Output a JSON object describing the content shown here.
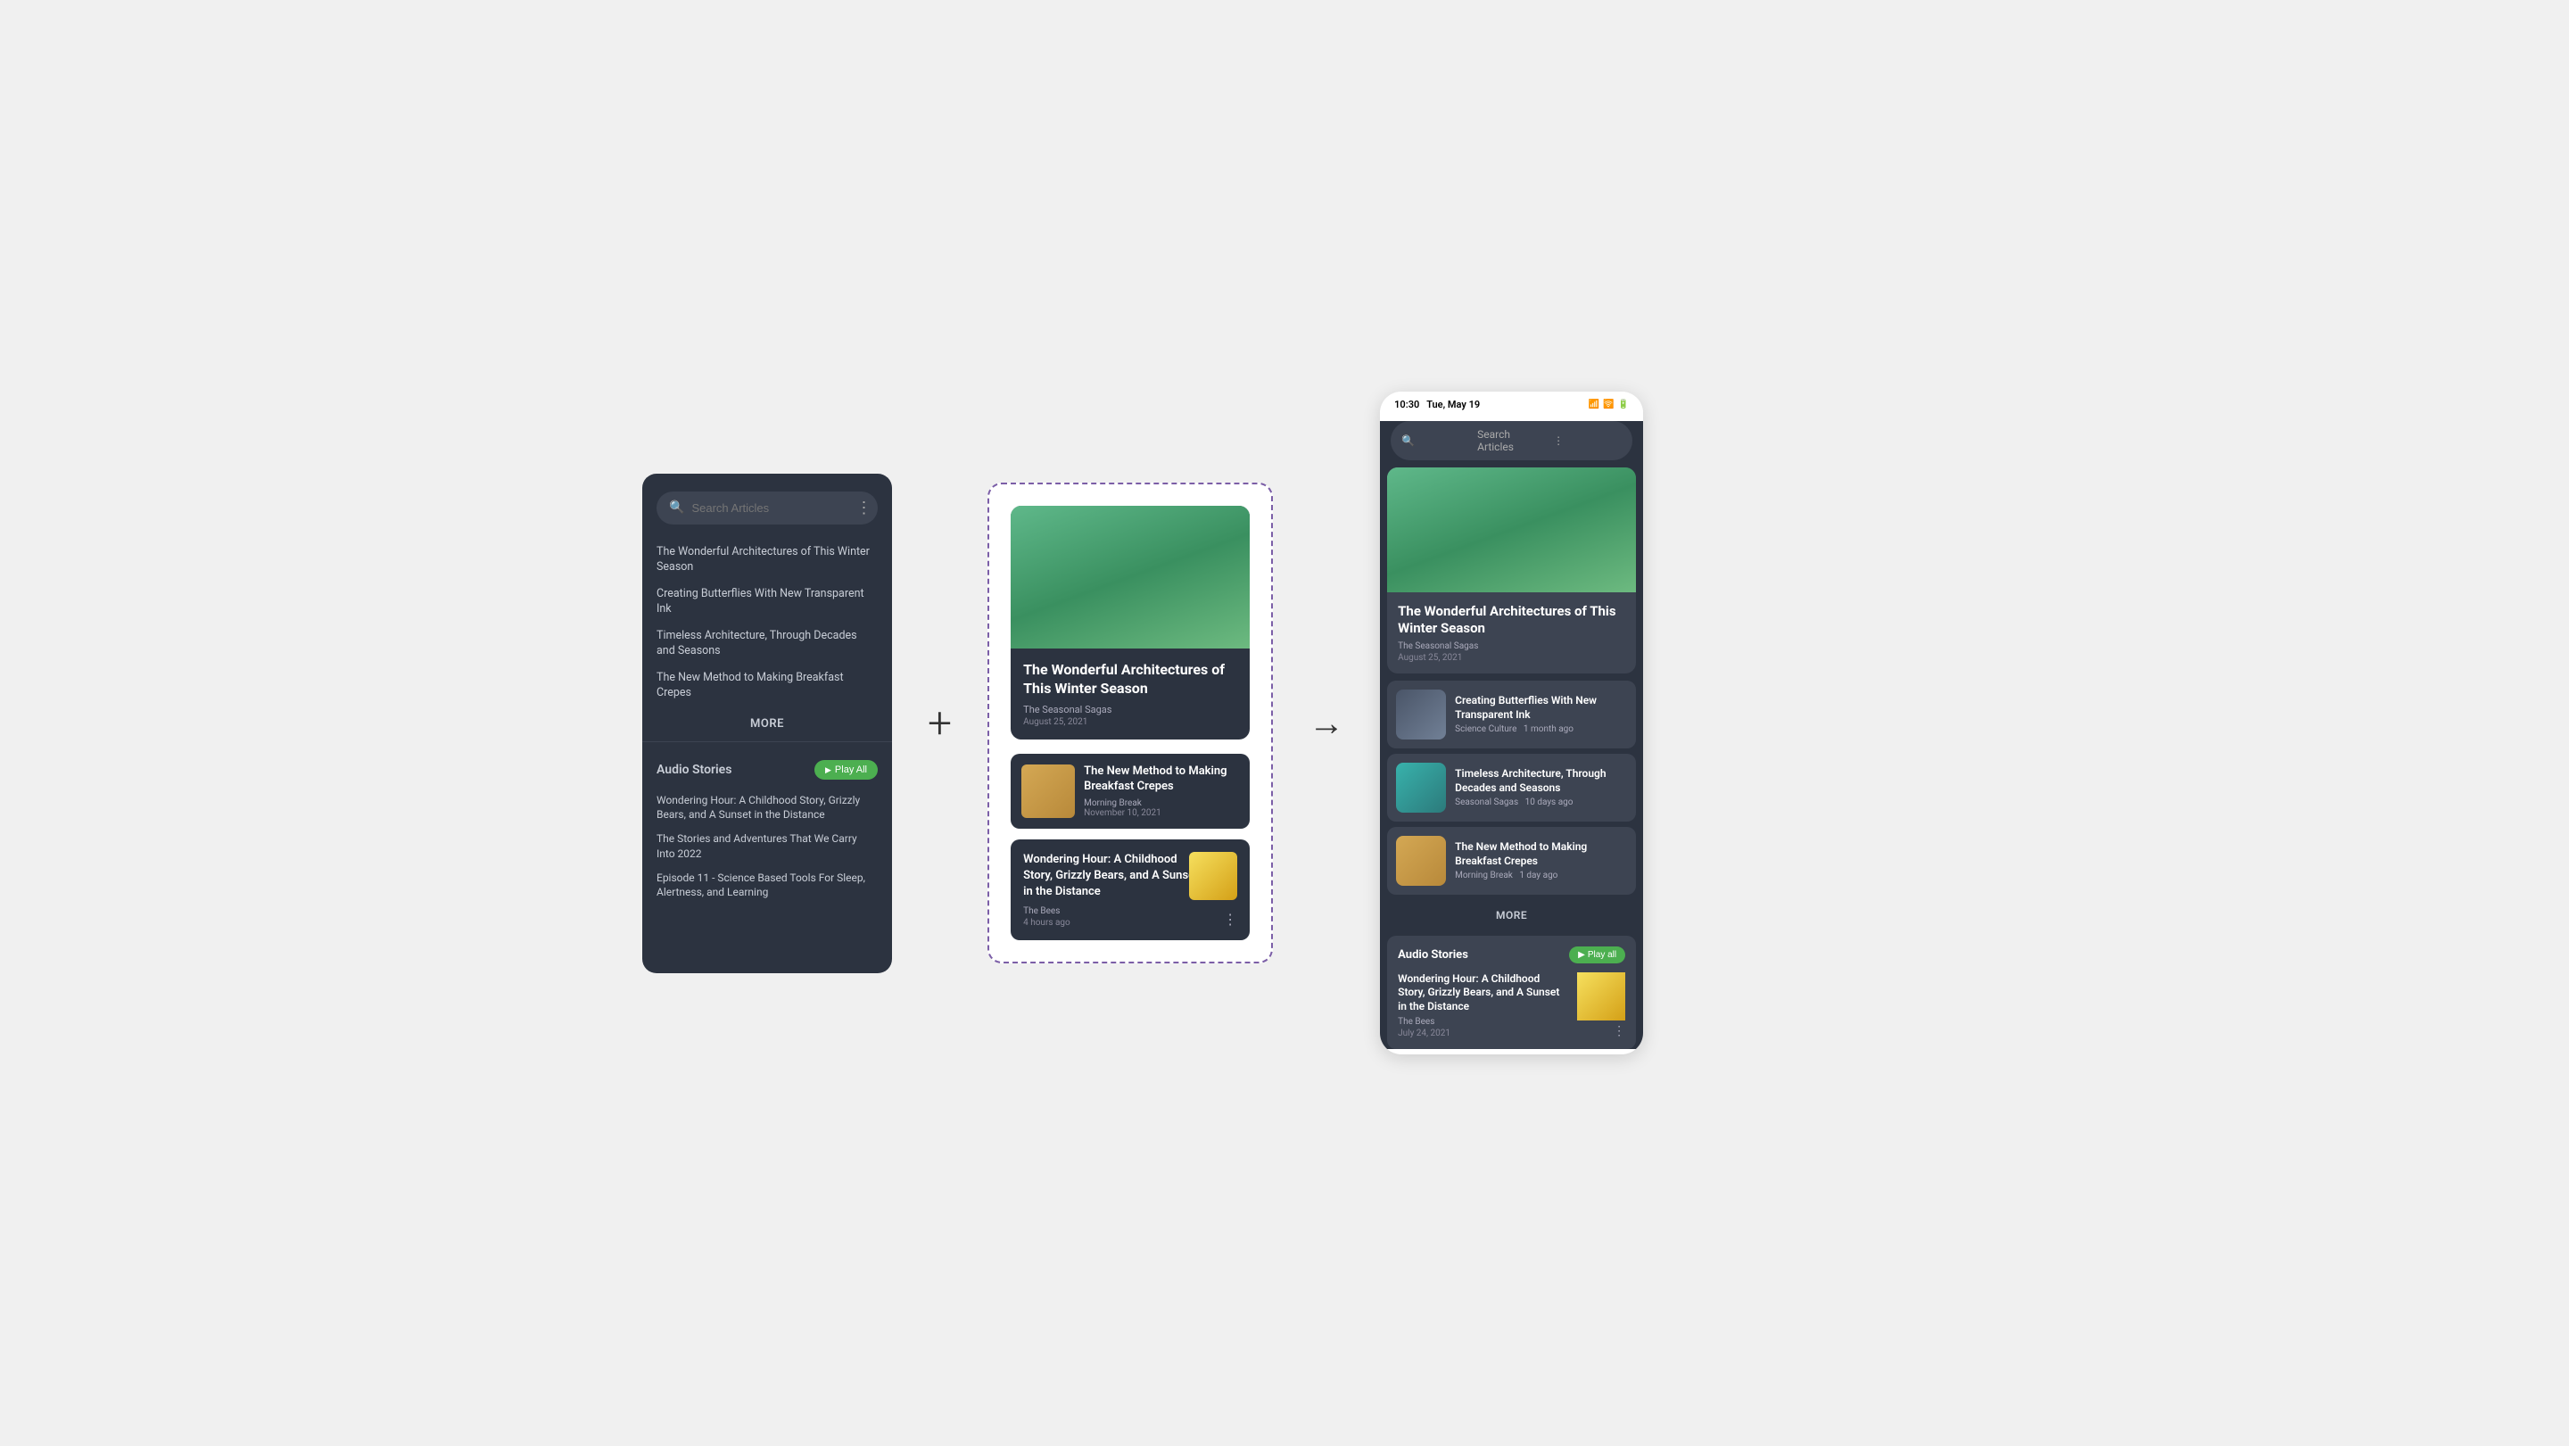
{
  "leftPhone": {
    "search": {
      "placeholder": "Search Articles"
    },
    "articles": [
      {
        "title": "The Wonderful Architectures of This Winter Season"
      },
      {
        "title": "Creating Butterflies With New Transparent Ink"
      },
      {
        "title": "Timeless Architecture, Through Decades and Seasons"
      },
      {
        "title": "The New Method to Making Breakfast Crepes"
      }
    ],
    "more_label": "MORE",
    "audioSection": {
      "title": "Audio Stories",
      "play_all": "Play All",
      "items": [
        {
          "title": "Wondering Hour: A Childhood Story, Grizzly Bears, and A Sunset in the Distance"
        },
        {
          "title": "The Stories and Adventures That We Carry Into 2022"
        },
        {
          "title": "Episode 11 - Science Based Tools For Sleep, Alertness, and Learning"
        }
      ]
    }
  },
  "centerBox": {
    "featured": {
      "title": "The Wonderful Architectures of This Winter Season",
      "subtitle": "The Seasonal Sagas",
      "date": "August 25, 2021"
    },
    "articles": [
      {
        "title": "The New Method to Making Breakfast Crepes",
        "category": "Morning Break",
        "date": "November 10, 2021"
      }
    ],
    "podcast": {
      "title": "Wondering Hour: A Childhood Story, Grizzly Bears, and A Sunset in the Distance",
      "author": "The Bees",
      "time": "4 hours ago"
    }
  },
  "rightPhone": {
    "statusBar": {
      "time": "10:30",
      "date": "Tue, May 19"
    },
    "search": {
      "placeholder": "Search Articles"
    },
    "featured": {
      "title": "The Wonderful Architectures of This Winter Season",
      "subtitle": "The Seasonal Sagas",
      "date": "August 25, 2021"
    },
    "articles": [
      {
        "title": "Creating Butterflies With New Transparent Ink",
        "category": "Science Culture",
        "time": "1 month ago"
      },
      {
        "title": "Timeless Architecture, Through Decades and Seasons",
        "category": "Seasonal Sagas",
        "time": "10 days ago"
      },
      {
        "title": "The New Method to Making Breakfast Crepes",
        "category": "Morning Break",
        "time": "1 day ago"
      }
    ],
    "more_label": "MORE",
    "audioSection": {
      "title": "Audio Stories",
      "play_all": "Play all",
      "podcast": {
        "title": "Wondering Hour: A Childhood Story, Grizzly Bears, and A Sunset in the Distance",
        "author": "The Bees",
        "date": "July 24, 2021"
      }
    }
  },
  "plus_symbol": "+",
  "arrow_symbol": "→"
}
